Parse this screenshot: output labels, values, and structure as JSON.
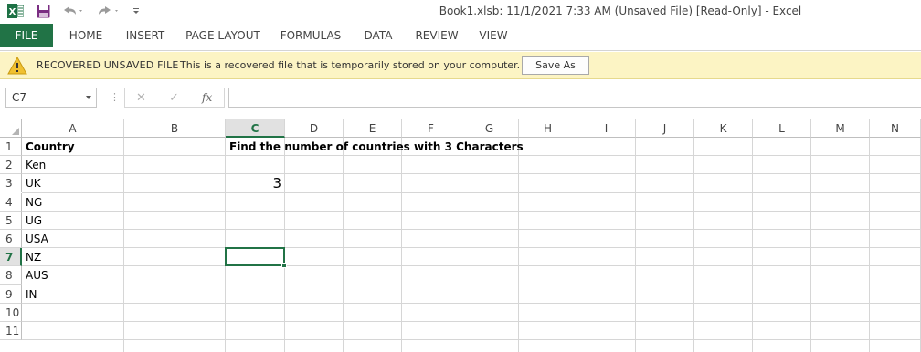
{
  "titlebar": {
    "title": "Book1.xlsb: 11/1/2021 7:33 AM (Unsaved File)  [Read-Only] - Excel",
    "icons": [
      "excel-logo",
      "save",
      "undo",
      "redo",
      "customize-quick-access"
    ]
  },
  "ribbon": {
    "tabs": [
      {
        "label": "FILE",
        "active": true
      },
      {
        "label": "HOME"
      },
      {
        "label": "INSERT"
      },
      {
        "label": "PAGE LAYOUT"
      },
      {
        "label": "FORMULAS"
      },
      {
        "label": "DATA"
      },
      {
        "label": "REVIEW"
      },
      {
        "label": "VIEW"
      }
    ]
  },
  "banner": {
    "title": "RECOVERED UNSAVED FILE",
    "message": "This is a recovered file that is temporarily stored on your computer.",
    "button": "Save As"
  },
  "formula_bar": {
    "name_box": "C7",
    "separator": "⋮",
    "cancel": "✕",
    "enter": "✓",
    "function": "fx",
    "value": ""
  },
  "grid": {
    "columns": [
      "A",
      "B",
      "C",
      "D",
      "E",
      "F",
      "G",
      "H",
      "I",
      "J",
      "K",
      "L",
      "M",
      "N"
    ],
    "rows": [
      "1",
      "2",
      "3",
      "4",
      "5",
      "6",
      "7",
      "8",
      "9",
      "10",
      "11"
    ],
    "selected_column": "C",
    "selected_row": "7",
    "cells": {
      "A1": "Country",
      "A2": "Ken",
      "A3": "UK",
      "A4": "NG",
      "A5": "UG",
      "A6": "USA",
      "A7": "NZ",
      "A8": "AUS",
      "A9": "IN",
      "C1": "Find the number of countries with 3 Characters",
      "C3": "3"
    }
  },
  "colors": {
    "accent": "#217346",
    "banner_bg": "#fcf4c4",
    "gridline": "#d6d6d6"
  }
}
